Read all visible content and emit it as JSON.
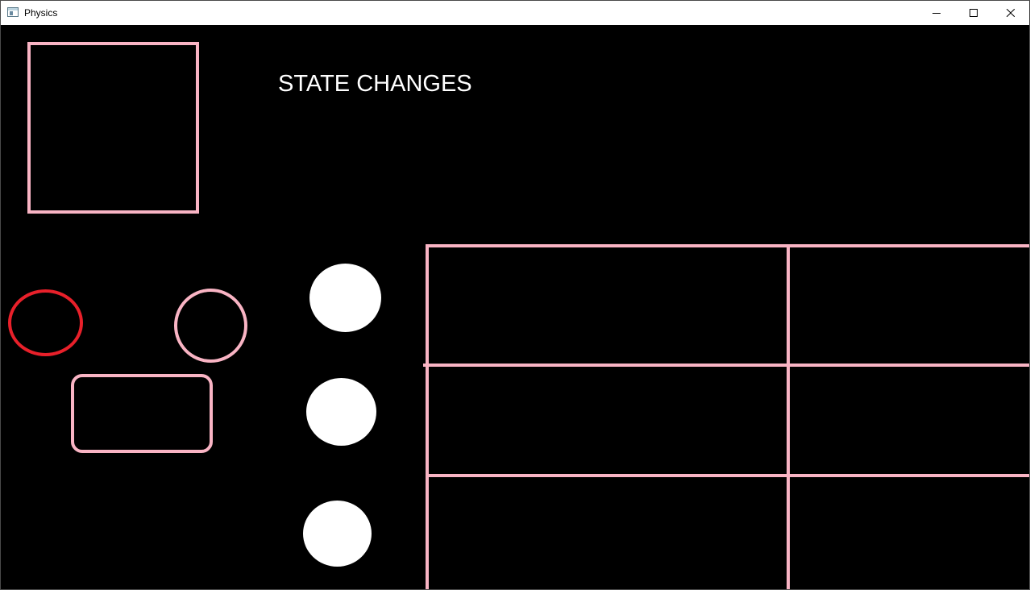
{
  "window": {
    "title": "Physics",
    "app_icon": "window-app-icon",
    "controls": {
      "minimize_icon": "minimize-icon",
      "maximize_icon": "maximize-icon",
      "close_icon": "close-icon"
    }
  },
  "canvas": {
    "background_color": "#000000",
    "heading": "STATE CHANGES",
    "heading_color": "#ffffff",
    "shapes": [
      {
        "name": "pink-square",
        "color": "#f9b4c4"
      },
      {
        "name": "red-ellipse",
        "color": "#e8202a"
      },
      {
        "name": "pink-circle",
        "color": "#f9b4c4"
      },
      {
        "name": "pink-rounded-rectangle",
        "color": "#f9b4c4"
      },
      {
        "name": "white-ball",
        "color": "#ffffff",
        "count": 3
      }
    ],
    "grid": {
      "color": "#f9b4c4",
      "horizontal_lines": 3,
      "vertical_lines": 2
    }
  }
}
